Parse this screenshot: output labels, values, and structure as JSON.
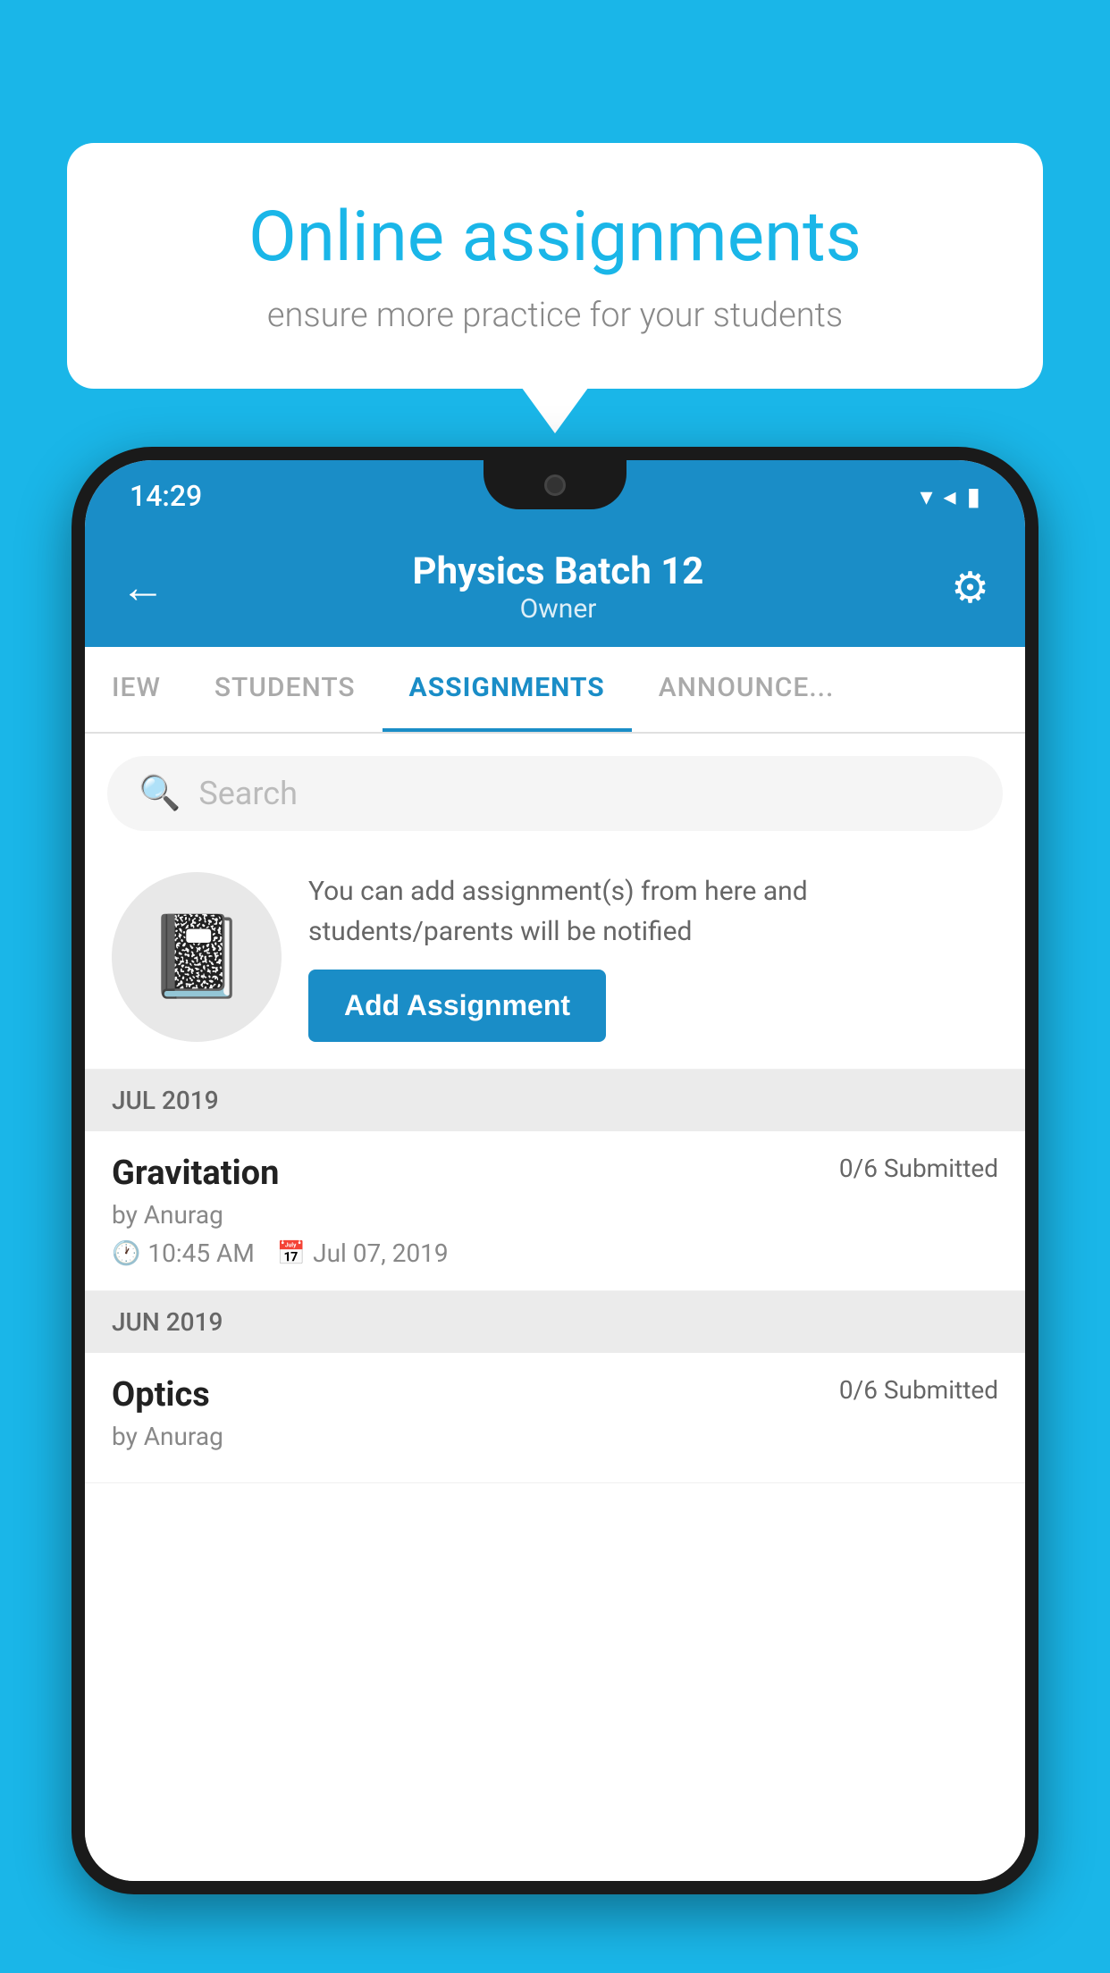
{
  "background_color": "#1ab6e8",
  "speech_bubble": {
    "title": "Online assignments",
    "subtitle": "ensure more practice for your students"
  },
  "phone": {
    "status_bar": {
      "time": "14:29",
      "wifi": "▼",
      "signal": "◀",
      "battery": "▮"
    },
    "header": {
      "title": "Physics Batch 12",
      "subtitle": "Owner",
      "back_label": "←",
      "settings_label": "⚙"
    },
    "tabs": [
      {
        "label": "IEW",
        "active": false
      },
      {
        "label": "STUDENTS",
        "active": false
      },
      {
        "label": "ASSIGNMENTS",
        "active": true
      },
      {
        "label": "ANNOUNCE...",
        "active": false
      }
    ],
    "search": {
      "placeholder": "Search"
    },
    "add_assignment": {
      "description": "You can add assignment(s) from here and students/parents will be notified",
      "button_label": "Add Assignment"
    },
    "sections": [
      {
        "month": "JUL 2019",
        "assignments": [
          {
            "name": "Gravitation",
            "submitted": "0/6 Submitted",
            "by": "by Anurag",
            "time": "10:45 AM",
            "date": "Jul 07, 2019"
          }
        ]
      },
      {
        "month": "JUN 2019",
        "assignments": [
          {
            "name": "Optics",
            "submitted": "0/6 Submitted",
            "by": "by Anurag",
            "time": "",
            "date": ""
          }
        ]
      }
    ]
  }
}
